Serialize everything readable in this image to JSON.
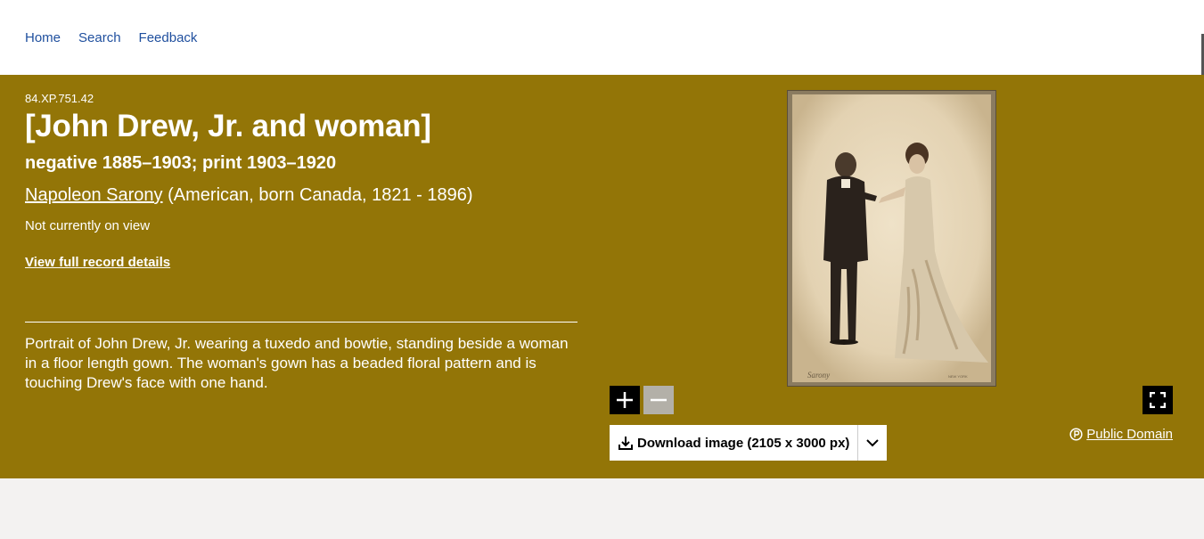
{
  "nav": {
    "items": [
      {
        "label": "Home"
      },
      {
        "label": "Search"
      },
      {
        "label": "Feedback"
      }
    ]
  },
  "object": {
    "accession": "84.XP.751.42",
    "title": "[John Drew, Jr. and woman]",
    "date": "negative 1885–1903; print 1903–1920",
    "maker_name": "Napoleon Sarony",
    "maker_bio": " (American, born Canada, 1821 - 1896)",
    "view_status": "Not currently on view",
    "record_link": "View full record details",
    "description": "Portrait of John Drew, Jr. wearing a tuxedo and bowtie, standing beside a woman in a floor length gown. The woman's gown has a beaded floral pattern and is touching Drew's face with one hand."
  },
  "viewer": {
    "download_label": "Download image (2105 x 3000 px)",
    "license_label": "Public Domain",
    "icons": [
      "zoom-in-icon",
      "zoom-out-icon",
      "fullscreen-icon",
      "download-icon",
      "chevron-down-icon",
      "public-domain-icon"
    ]
  },
  "colors": {
    "hero_background": "#937507",
    "nav_link": "#1f4f9e",
    "page_background": "#f3f2f1"
  }
}
